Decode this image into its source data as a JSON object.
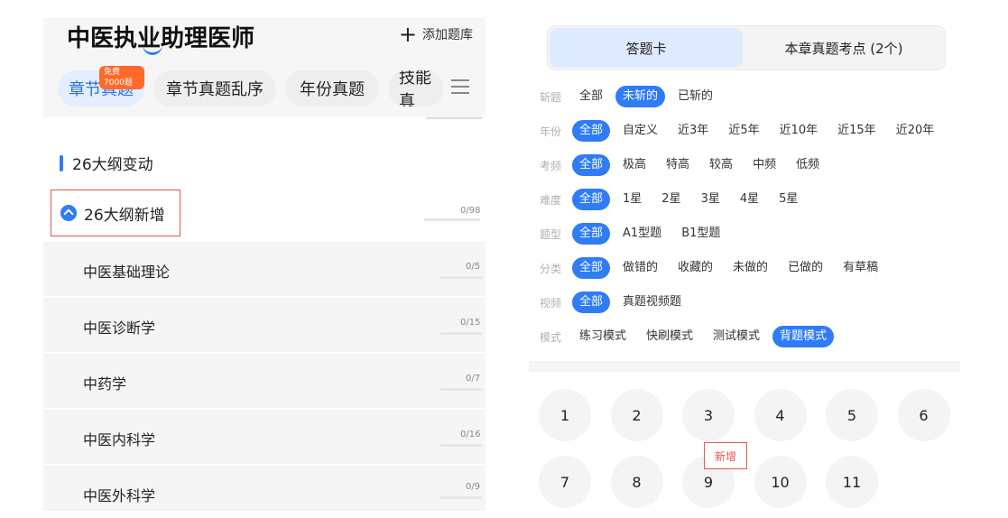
{
  "left": {
    "app_title": "中医执业助理医师",
    "add_bank_label": "添加题库",
    "tabs": [
      {
        "label": "章节真题",
        "badge": "免费7000题",
        "active": true
      },
      {
        "label": "章节真题乱序",
        "active": false
      },
      {
        "label": "年份真题",
        "active": false
      },
      {
        "label": "技能真",
        "active": false
      }
    ],
    "section_title": "26大纲变动",
    "expanded": {
      "label": "26大纲新增",
      "progress": "0/98"
    },
    "sub_items": [
      {
        "label": "中医基础理论",
        "progress": "0/5"
      },
      {
        "label": "中医诊断学",
        "progress": "0/15"
      },
      {
        "label": "中药学",
        "progress": "0/7"
      },
      {
        "label": "中医内科学",
        "progress": "0/16"
      },
      {
        "label": "中医外科学",
        "progress": "0/9"
      }
    ]
  },
  "right": {
    "segments": [
      {
        "label": "答题卡",
        "active": true
      },
      {
        "label": "本章真题考点 (2个)",
        "active": false
      }
    ],
    "filters": [
      {
        "label": "斩题",
        "options": [
          "全部",
          "未斩的",
          "已斩的"
        ],
        "selected": 1
      },
      {
        "label": "年份",
        "options": [
          "全部",
          "自定义",
          "近3年",
          "近5年",
          "近10年",
          "近15年",
          "近20年"
        ],
        "selected": 0
      },
      {
        "label": "考频",
        "options": [
          "全部",
          "极高",
          "特高",
          "较高",
          "中频",
          "低频"
        ],
        "selected": 0
      },
      {
        "label": "难度",
        "options": [
          "全部",
          "1星",
          "2星",
          "3星",
          "4星",
          "5星"
        ],
        "selected": 0
      },
      {
        "label": "题型",
        "options": [
          "全部",
          "A1型题",
          "B1型题"
        ],
        "selected": 0
      },
      {
        "label": "分类",
        "options": [
          "全部",
          "做错的",
          "收藏的",
          "未做的",
          "已做的",
          "有草稿"
        ],
        "selected": 0
      },
      {
        "label": "视频",
        "options": [
          "全部",
          "真题视频题"
        ],
        "selected": 0
      },
      {
        "label": "模式",
        "options": [
          "练习模式",
          "快刷模式",
          "测试模式",
          "背题模式"
        ],
        "selected": 3
      }
    ],
    "numbers": [
      "1",
      "2",
      "3",
      "4",
      "5",
      "6",
      "7",
      "8",
      "9",
      "10",
      "11"
    ],
    "new_tag": "新增"
  },
  "colors": {
    "accent": "#2f7cf6",
    "highlight_border": "#e0584f",
    "badge": "#ff6a2a"
  }
}
